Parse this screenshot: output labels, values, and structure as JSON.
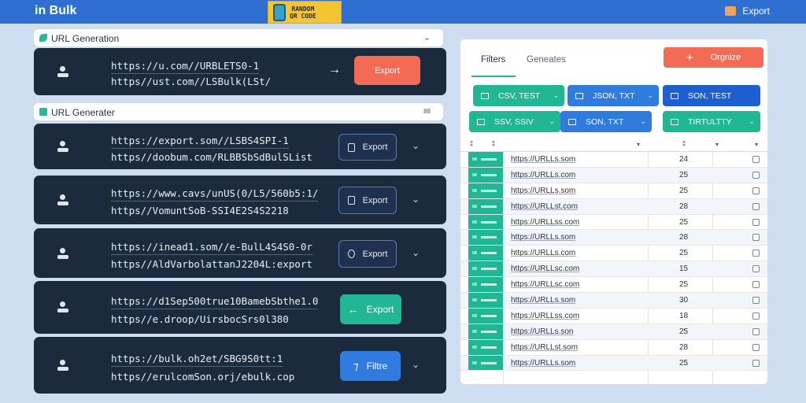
{
  "app": {
    "title": "in Bulk",
    "logo_text_1": "RANDOM",
    "logo_text_2": "QR CODE",
    "export_label": "Export"
  },
  "left": {
    "section1": {
      "label": "URL Generation",
      "chevron": "⌄"
    },
    "section2": {
      "label": "URL Generater",
      "chevron": "88"
    },
    "rows": [
      {
        "url1": "https://u.com//URBLETS0-1",
        "url2": "https//ust.com//LSBulk(LSt/",
        "button": "Export",
        "style": "orange",
        "trailing": "→"
      },
      {
        "url1": "https://export.som//LSBS4SPI-1",
        "url2": "https//doobum.com/RLBBSbSdBulSList",
        "button": "Export",
        "style": "outline",
        "trailing": "⌄"
      },
      {
        "url1": "https://www.cavs/unUS(0/L5/560b5:1/",
        "url2": "https//VomuntSoB-SSI4E2S4S2218",
        "button": "Export",
        "style": "outline",
        "trailing": "⌄"
      },
      {
        "url1": "https://inead1.som//e-BulL4S4S0-0r",
        "url2": "https//AldVarbolattanJ2204L:export",
        "button": "Export",
        "style": "outline",
        "trailing": "⌄"
      },
      {
        "url1": "https://d1Sep500true10BamebSbthe1.0",
        "url2": "https//e.droop/UirsbocSrs0l380",
        "button": "Export",
        "style": "green",
        "trailing": ""
      },
      {
        "url1": "https://bulk.oh2et/SBG9S0tt:1",
        "url2": "https//erulcomSon.orj/ebulk.cop",
        "button": "Filtre",
        "style": "blue",
        "trailing": "⌄"
      }
    ]
  },
  "right": {
    "tabs": [
      "Filters",
      "Geneates"
    ],
    "organize_label": "Orgnize",
    "formats": [
      {
        "label": "CSV, TEST",
        "color": "green"
      },
      {
        "label": "JSON, TXT",
        "color": "blue"
      },
      {
        "label": "SON, TEST",
        "color": "navy"
      },
      {
        "label": "SSV, SSIV",
        "color": "green"
      },
      {
        "label": "SON, TXT",
        "color": "blue"
      },
      {
        "label": "TIRTULTTY",
        "color": "green"
      }
    ],
    "table": {
      "rows": [
        {
          "url": "https://URLLs.som",
          "count": "24"
        },
        {
          "url": "https://URLLs.com",
          "count": "25"
        },
        {
          "url": "https://URLLs.som",
          "count": "25"
        },
        {
          "url": "https://URLLst.com",
          "count": "28"
        },
        {
          "url": "https://URLLss.com",
          "count": "25"
        },
        {
          "url": "https://URLLs.som",
          "count": "28"
        },
        {
          "url": "https://URLLs.com",
          "count": "25"
        },
        {
          "url": "https://URLLsc.com",
          "count": "15"
        },
        {
          "url": "https://URLLsc.com",
          "count": "25"
        },
        {
          "url": "https://URLLs.som",
          "count": "30"
        },
        {
          "url": "https://URLLss.com",
          "count": "18"
        },
        {
          "url": "https://URLLs.son",
          "count": "25"
        },
        {
          "url": "https://URLLst.som",
          "count": "28"
        },
        {
          "url": "https://URLLs.som",
          "count": "25"
        }
      ]
    }
  }
}
